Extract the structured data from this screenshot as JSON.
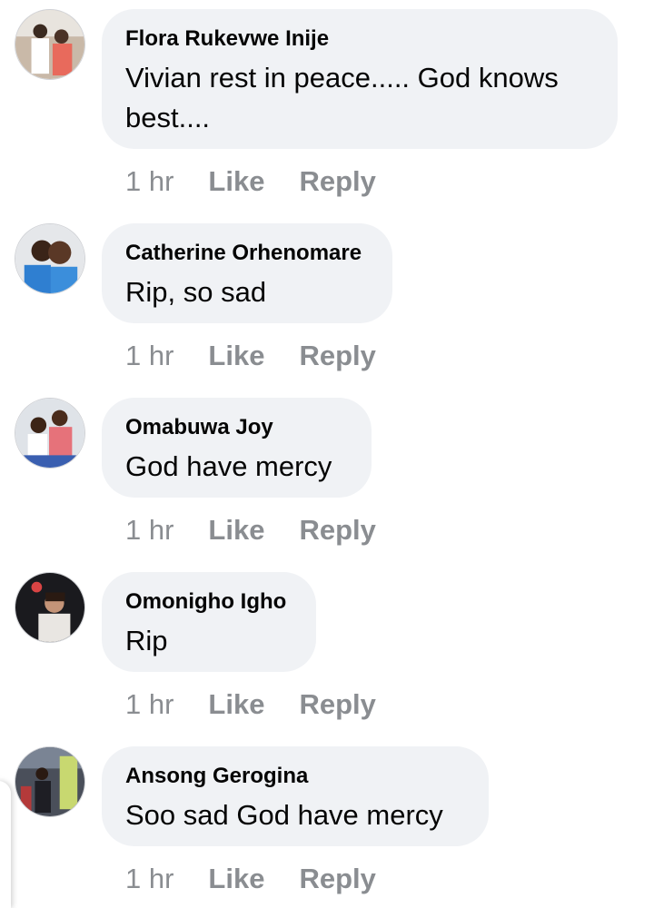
{
  "comments": [
    {
      "author": "Flora Rukevwe Inije",
      "text": "Vivian rest in peace..... God knows best....",
      "time": "1 hr",
      "like": "Like",
      "reply": "Reply",
      "avatar_icon": "profile-photo-couple"
    },
    {
      "author": "Catherine Orhenomare",
      "text": "Rip, so sad",
      "time": "1 hr",
      "like": "Like",
      "reply": "Reply",
      "avatar_icon": "profile-photo-couple-smiling"
    },
    {
      "author": "Omabuwa Joy",
      "text": "God have mercy",
      "time": "1 hr",
      "like": "Like",
      "reply": "Reply",
      "avatar_icon": "profile-photo-mother-child"
    },
    {
      "author": "Omonigho Igho",
      "text": "Rip",
      "time": "1 hr",
      "like": "Like",
      "reply": "Reply",
      "avatar_icon": "profile-photo-portrait"
    },
    {
      "author": "Ansong Gerogina",
      "text": "Soo sad God have mercy",
      "time": "1 hr",
      "like": "Like",
      "reply": "Reply",
      "avatar_icon": "profile-photo-street"
    }
  ],
  "colors": {
    "bubble": "#f0f2f5",
    "author": "#050505",
    "meta": "#8a8d91"
  }
}
